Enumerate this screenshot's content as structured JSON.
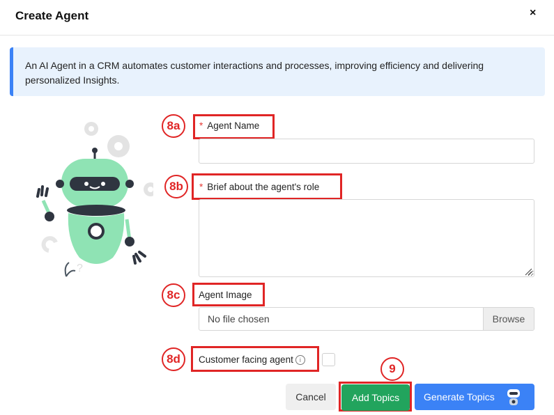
{
  "dialog": {
    "title": "Create Agent",
    "close_symbol": "×"
  },
  "info": {
    "text": "An AI Agent in a CRM automates customer interactions and processes, improving efficiency and delivering personalized Insights."
  },
  "form": {
    "agent_name_label": "Agent Name",
    "brief_label": "Brief about the agent's role",
    "image_label": "Agent Image",
    "file_status": "No file chosen",
    "browse_label": "Browse",
    "customer_facing_label": "Customer facing agent",
    "required_marker": "*",
    "info_symbol": "i"
  },
  "buttons": {
    "cancel": "Cancel",
    "add_topics": "Add Topics",
    "generate_topics": "Generate Topics"
  },
  "annotations": {
    "name": "8a",
    "brief": "8b",
    "image": "8c",
    "customer": "8d",
    "add_topics": "9"
  },
  "icons": {
    "close": "close-icon",
    "robot": "robot-illustration",
    "info": "info-icon",
    "generate": "robot-icon",
    "resize": "resize-grip-icon"
  },
  "colors": {
    "accent_blue": "#3b82f6",
    "add_green": "#22a45d",
    "annotation_red": "#e02525",
    "robot_green": "#8fe3b4",
    "info_bg": "#e8f2fd"
  }
}
